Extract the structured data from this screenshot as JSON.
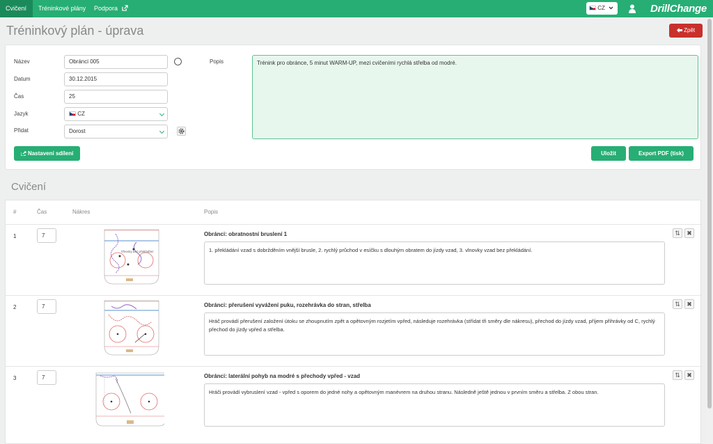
{
  "nav": {
    "items": [
      "Cvičení",
      "Tréninkové plány",
      "Podpora"
    ],
    "lang": "CZ",
    "brand": "DrillChange"
  },
  "page": {
    "title": "Tréninkový plán - úprava",
    "back_label": "Zpět"
  },
  "form": {
    "name_label": "Název",
    "name_value": "Obránci 005",
    "date_label": "Datum",
    "date_value": "30.12.2015",
    "time_label": "Čas",
    "time_value": "25",
    "lang_label": "Jazyk",
    "lang_value": "CZ",
    "add_label": "Přidat",
    "add_value": "Dorost",
    "desc_label": "Popis",
    "desc_value": "Trénink pro obránce, 5 minut WARM-UP, mezi cvičeními rychlá střelba od modré.",
    "share_button": "Nastavení sdílení",
    "save_button": "Uložit",
    "export_button": "Export PDF (tisk)"
  },
  "exercises": {
    "section_title": "Cvičení",
    "headers": [
      "#",
      "Čas",
      "Nákres",
      "Popis"
    ],
    "rows": [
      {
        "num": "1",
        "time": "7",
        "title": "Obránci: obratnostní bruslení 1",
        "desc": "1. překládání vzad s dobržděním vnější brusle, 2. rychlý průchod v esíčku s dlouhým obratem do jízdy vzad, 3. vlnovky vzad bez překládání.",
        "drawing_text": "Vlnovky bez překládání"
      },
      {
        "num": "2",
        "time": "7",
        "title": "Obránci: přerušení vyvážení puku, rozehrávka do stran, střelba",
        "desc": "Hráč provádí přerušení založení útoku se zhoupnutím zpět a opětovným rozjetím vpřed, následuje rozehrávka (střídat tři směry dle nákresu), přechod do jízdy vzad, příjem přihrávky od C, rychlý přechod do jízdy vpřed a střelba.",
        "drawing_text": ""
      },
      {
        "num": "3",
        "time": "7",
        "title": "Obránci: laterální pohyb na modré s přechody vpřed - vzad",
        "desc": "Hráči provádí vybruslení vzad - vpřed s oporem do jedné nohy a opětovným manévrem na druhou stranu. Následně ještě jednou v prvním směru a střelba. Z obou stran.",
        "drawing_text": ""
      }
    ]
  },
  "colors": {
    "primary": "#27ae74",
    "danger": "#c9302c",
    "textarea_bg": "#e8f7ee"
  }
}
